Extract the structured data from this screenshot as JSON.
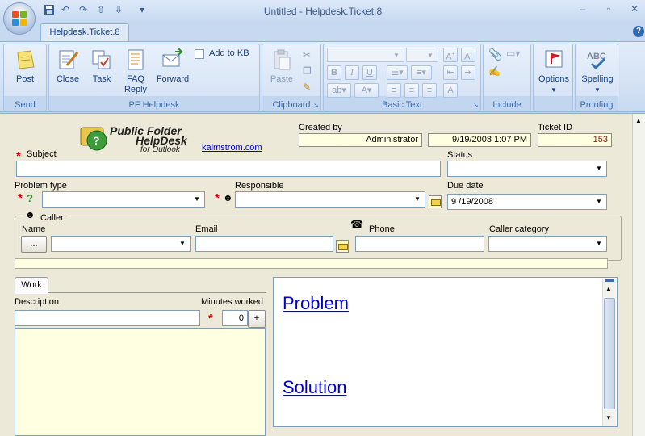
{
  "window": {
    "title": "Untitled - Helpdesk.Ticket.8",
    "tab": "Helpdesk.Ticket.8",
    "help": "?"
  },
  "ribbon": {
    "send": {
      "label": "Send",
      "post": "Post"
    },
    "pf_helpdesk": {
      "label": "PF Helpdesk",
      "close": "Close",
      "task": "Task",
      "faq_reply_1": "FAQ",
      "faq_reply_2": "Reply",
      "forward": "Forward",
      "add_to_kb": "Add to KB"
    },
    "clipboard": {
      "label": "Clipboard",
      "paste": "Paste"
    },
    "basic_text": {
      "label": "Basic Text"
    },
    "include": {
      "label": "Include"
    },
    "options": {
      "label": "Options"
    },
    "proofing": {
      "label": "Proofing",
      "spelling": "Spelling"
    }
  },
  "form": {
    "logo": {
      "line1": "Public Folder",
      "line2": "HelpDesk",
      "line3": "for Outlook"
    },
    "vendor_link": "kalmstrom.com",
    "created_by": {
      "label": "Created by",
      "user": "Administrator",
      "date": "9/19/2008 1:07 PM"
    },
    "ticket_id": {
      "label": "Ticket ID",
      "value": "153"
    },
    "subject": {
      "label": "Subject",
      "value": ""
    },
    "status": {
      "label": "Status",
      "value": ""
    },
    "problem_type": {
      "label": "Problem type",
      "value": ""
    },
    "responsible": {
      "label": "Responsible",
      "value": ""
    },
    "due_date": {
      "label": "Due date",
      "value": "9 /19/2008"
    },
    "caller": {
      "label": "Caller",
      "name_label": "Name",
      "name_button": "...",
      "email_label": "Email",
      "phone_label": "Phone",
      "category_label": "Caller category"
    },
    "work": {
      "tab": "Work",
      "description_label": "Description",
      "minutes_label": "Minutes worked",
      "minutes_value": "0",
      "plus": "+"
    },
    "document": {
      "problem_link": "Problem",
      "solution_link": "Solution"
    }
  },
  "colors": {
    "accent": "#15428b",
    "required": "#e00000",
    "link": "#0000cc",
    "yellow_field": "#ffffe1"
  }
}
